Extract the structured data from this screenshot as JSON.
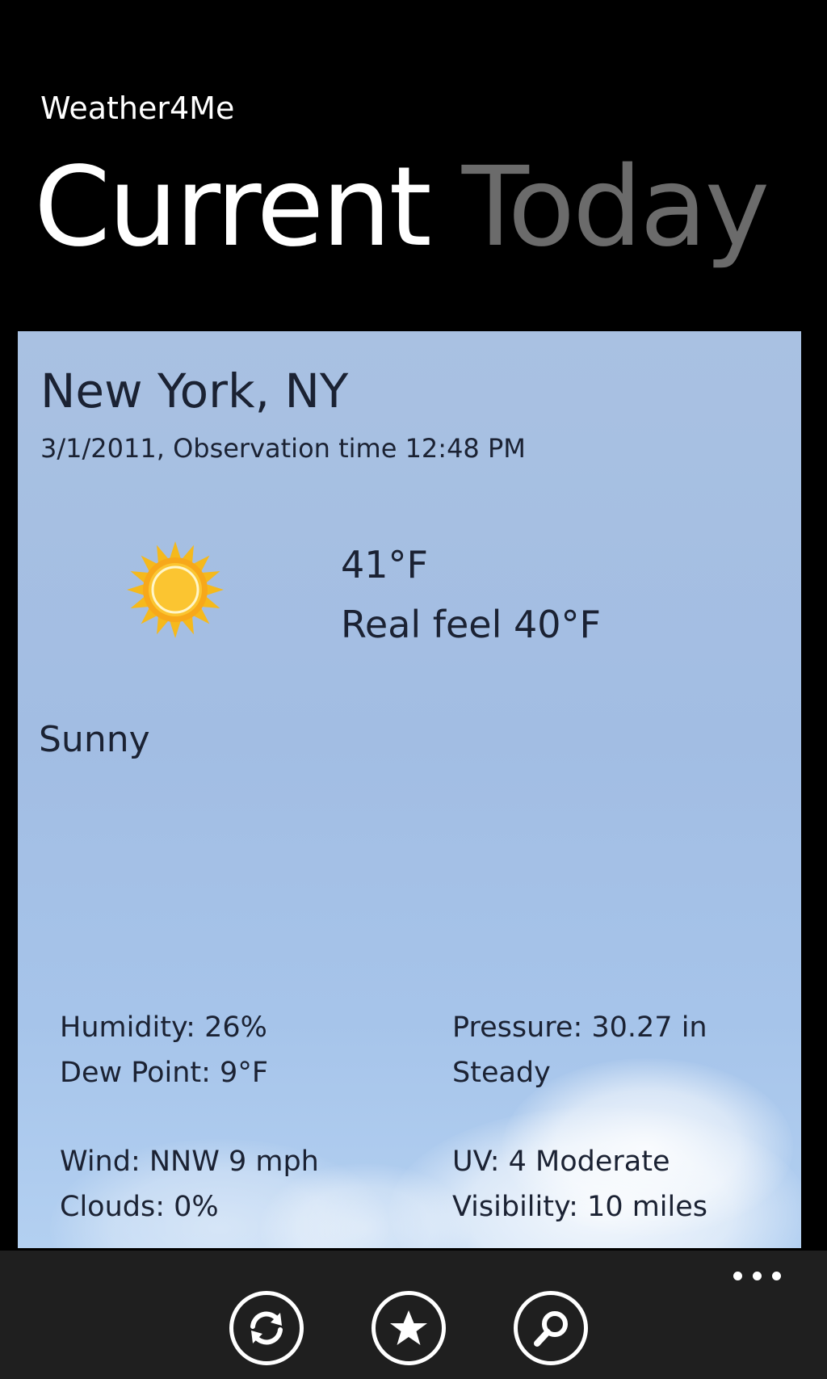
{
  "app": {
    "title": "Weather4Me"
  },
  "pivot": {
    "items": [
      "Current",
      "Today"
    ],
    "selected": "Current"
  },
  "current": {
    "location": "New York, NY",
    "observation": "3/1/2011, Observation time 12:48 PM",
    "icon": "sun-icon",
    "temperature": "41°F",
    "real_feel": "Real feel 40°F",
    "condition": "Sunny",
    "details": {
      "humidity": "Humidity: 26%",
      "dew_point": "Dew Point: 9°F",
      "pressure": "Pressure: 30.27 in",
      "pressure_trend": "Steady",
      "wind": "Wind: NNW 9 mph",
      "clouds": "Clouds: 0%",
      "uv": "UV: 4 Moderate",
      "visibility": "Visibility: 10 miles"
    }
  },
  "app_bar": {
    "buttons": [
      {
        "icon": "refresh-icon"
      },
      {
        "icon": "star-icon"
      },
      {
        "icon": "search-icon"
      }
    ],
    "more_icon": "more-icon"
  },
  "colors": {
    "background": "#000000",
    "pivot_active": "#ffffff",
    "pivot_inactive": "#6b6b6b",
    "sky": "#a2bde3",
    "sun": "#f5b91c",
    "app_bar": "#1f1f1f",
    "text_dark": "#1b2233"
  }
}
